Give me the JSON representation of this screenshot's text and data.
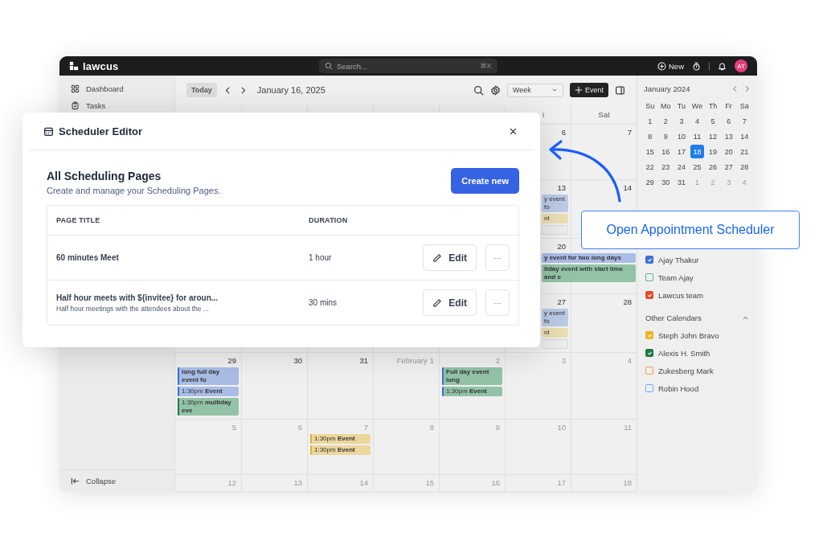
{
  "topbar": {
    "logo": "lawcus",
    "search": {
      "placeholder": "Search...",
      "shortcut": "⌘K"
    },
    "new_button": "New",
    "avatar": "AT"
  },
  "sidebar": {
    "items": [
      {
        "label": "Dashboard"
      },
      {
        "label": "Tasks"
      }
    ],
    "collapse": "Collapse"
  },
  "toolbar": {
    "today": "Today",
    "date": "January 16, 2025",
    "view": "Week",
    "event_button": "Event"
  },
  "calendar": {
    "weekdays": {
      "fri": "i",
      "sat": "Sat"
    },
    "weeks": [
      {
        "fri": {
          "date": "6",
          "in_month": true
        },
        "sat": {
          "date": "7",
          "in_month": true
        }
      },
      {
        "fri": {
          "date": "13",
          "in_month": true,
          "events": [
            {
              "kind": "bar",
              "text": "y event fo",
              "color": "#bccbe8",
              "all_day": false
            },
            {
              "kind": "bar",
              "text": "nt",
              "color": "#ecdfb2",
              "all_day": false
            },
            {
              "kind": "outline"
            }
          ]
        },
        "sat": {
          "date": "14",
          "in_month": true
        }
      },
      {
        "fri": {
          "date": "20",
          "in_month": true,
          "events": [
            {
              "kind": "span",
              "text": "y event for two long days",
              "color": "#a9bde6",
              "all_day": true
            },
            {
              "kind": "span",
              "text": "tiday event with start time and e",
              "color": "#93c3a6",
              "all_day": true
            }
          ]
        }
      },
      {
        "fri": {
          "date": "27",
          "in_month": true,
          "events": [
            {
              "kind": "bar",
              "text": "y event fo",
              "color": "#bccbe8",
              "all_day": false
            },
            {
              "kind": "bar",
              "text": "nt",
              "color": "#ecdfb2",
              "all_day": false
            },
            {
              "kind": "outline"
            }
          ]
        },
        "sat": {
          "date": "28",
          "in_month": true
        }
      },
      {
        "sun": {
          "date": "29",
          "in_month": true,
          "events": [
            {
              "kind": "bar",
              "text": "long full day event fo",
              "color": "#a9bde6",
              "accent": {
                "color": "#3b6fd8"
              },
              "all_day": true
            },
            {
              "kind": "bar",
              "text": "1:30pm **Event**",
              "color": "#a9bde6",
              "accent": {
                "color": "#3b6fd8"
              },
              "all_day": false
            },
            {
              "kind": "bar",
              "text": "1:30pm **multiday eve**",
              "color": "#93c3a6",
              "accent": {
                "color": "#1e7b45"
              },
              "all_day": false
            }
          ]
        },
        "mon": {
          "date": "30",
          "in_month": true
        },
        "tue": {
          "date": "31",
          "in_month": true
        },
        "wed": {
          "month": "February",
          "date": "1",
          "in_month": false
        },
        "thu": {
          "date": "2",
          "in_month": false,
          "events": [
            {
              "kind": "bar",
              "text": "Full day event long",
              "color": "#93c3a6",
              "accent": {
                "color": "#3b6fd8"
              },
              "all_day": true
            },
            {
              "kind": "bar",
              "text": "1:30pm **Event**",
              "color": "#93c3a6",
              "accent": {
                "color": "#3b6fd8"
              },
              "all_day": false
            }
          ]
        },
        "fri": {
          "date": "3",
          "in_month": false
        },
        "sat": {
          "date": "4",
          "in_month": false
        }
      },
      {
        "sun": {
          "date": "5",
          "in_month": false
        },
        "mon": {
          "date": "6",
          "in_month": false
        },
        "tue": {
          "date": "7",
          "in_month": false,
          "events": [
            {
              "kind": "bar",
              "text": "1:30pm **Event**",
              "color": "#ecd69c",
              "accent": {
                "color": "#e0b23a"
              },
              "all_day": false
            },
            {
              "kind": "bar",
              "text": "1:30pm **Event**",
              "color": "#ecd69c",
              "accent": {
                "color": "#e0b23a"
              },
              "all_day": false
            }
          ]
        },
        "wed": {
          "date": "8",
          "in_month": false
        },
        "thu": {
          "date": "9",
          "in_month": false
        },
        "fri": {
          "date": "10",
          "in_month": false
        },
        "sat": {
          "date": "11",
          "in_month": false
        }
      },
      {
        "sun": {
          "date": "12",
          "in_month": false
        },
        "mon": {
          "date": "13",
          "in_month": false
        },
        "tue": {
          "date": "14",
          "in_month": false
        },
        "wed": {
          "date": "15",
          "in_month": false
        },
        "thu": {
          "date": "16",
          "in_month": false
        },
        "fri": {
          "date": "17",
          "in_month": false
        },
        "sat": {
          "date": "18",
          "in_month": false
        }
      }
    ]
  },
  "mini_calendar": {
    "title": "January 2024",
    "weekdays": [
      "Su",
      "Mo",
      "Tu",
      "We",
      "Th",
      "Fr",
      "Sa"
    ],
    "days": [
      {
        "label": "1",
        "in_month": true,
        "selected": false
      },
      {
        "label": "2",
        "in_month": true,
        "selected": false
      },
      {
        "label": "3",
        "in_month": true,
        "selected": false
      },
      {
        "label": "4",
        "in_month": true,
        "selected": false
      },
      {
        "label": "5",
        "in_month": true,
        "selected": false
      },
      {
        "label": "6",
        "in_month": true,
        "selected": false
      },
      {
        "label": "7",
        "in_month": true,
        "selected": false
      },
      {
        "label": "8",
        "in_month": true,
        "selected": false
      },
      {
        "label": "9",
        "in_month": true,
        "selected": false
      },
      {
        "label": "10",
        "in_month": true,
        "selected": false
      },
      {
        "label": "11",
        "in_month": true,
        "selected": false
      },
      {
        "label": "12",
        "in_month": true,
        "selected": false
      },
      {
        "label": "13",
        "in_month": true,
        "selected": false
      },
      {
        "label": "14",
        "in_month": true,
        "selected": false
      },
      {
        "label": "15",
        "in_month": true,
        "selected": false
      },
      {
        "label": "16",
        "in_month": true,
        "selected": false
      },
      {
        "label": "17",
        "in_month": true,
        "selected": false
      },
      {
        "label": "18",
        "in_month": true,
        "selected": true
      },
      {
        "label": "19",
        "in_month": true,
        "selected": false
      },
      {
        "label": "20",
        "in_month": true,
        "selected": false
      },
      {
        "label": "21",
        "in_month": true,
        "selected": false
      },
      {
        "label": "22",
        "in_month": true,
        "selected": false
      },
      {
        "label": "23",
        "in_month": true,
        "selected": false
      },
      {
        "label": "24",
        "in_month": true,
        "selected": false
      },
      {
        "label": "25",
        "in_month": true,
        "selected": false
      },
      {
        "label": "26",
        "in_month": true,
        "selected": false
      },
      {
        "label": "27",
        "in_month": true,
        "selected": false
      },
      {
        "label": "28",
        "in_month": true,
        "selected": false
      },
      {
        "label": "29",
        "in_month": true,
        "selected": false
      },
      {
        "label": "30",
        "in_month": true,
        "selected": false
      },
      {
        "label": "31",
        "in_month": true,
        "selected": false
      },
      {
        "label": "1",
        "in_month": false,
        "selected": false
      },
      {
        "label": "2",
        "in_month": false,
        "selected": false
      },
      {
        "label": "3",
        "in_month": false,
        "selected": false
      },
      {
        "label": "4",
        "in_month": false,
        "selected": false
      }
    ]
  },
  "my_calendars": [
    {
      "label": "Ajay Thakur",
      "checked": true,
      "color": "#3b6fd8"
    },
    {
      "label": "Team Ajay",
      "checked": false,
      "color": "#58b88a"
    },
    {
      "label": "Lawcus team",
      "checked": true,
      "color": "#e0502a"
    }
  ],
  "other_calendars": {
    "title": "Other Calendars",
    "expanded": true,
    "items": [
      {
        "label": "Steph John Bravo",
        "checked": true,
        "color": "#f0b323"
      },
      {
        "label": "Alexis H. Smith",
        "checked": true,
        "color": "#1e7b45"
      },
      {
        "label": "Zukesberg Mark",
        "checked": false,
        "color": "#f0a050"
      },
      {
        "label": "Robin Hood",
        "checked": false,
        "color": "#7aa5f0"
      }
    ]
  },
  "modal": {
    "title": "Scheduler Editor",
    "heading": "All Scheduling Pages",
    "subtitle": "Create and manage your Scheduling Pages.",
    "create_button": "Create new",
    "columns": [
      "PAGE TITLE",
      "DURATION"
    ],
    "rows": [
      {
        "title": "60 minutes Meet",
        "duration": "1 hour",
        "edit": "Edit",
        "more": "···"
      },
      {
        "title": "Half hour meets with ${invitee} for aroun...",
        "description": "Half hour meetings with the attendees about the ...",
        "duration": "30 mins",
        "edit": "Edit",
        "more": "···"
      }
    ]
  },
  "callout": {
    "text": "Open Appointment Scheduler"
  }
}
